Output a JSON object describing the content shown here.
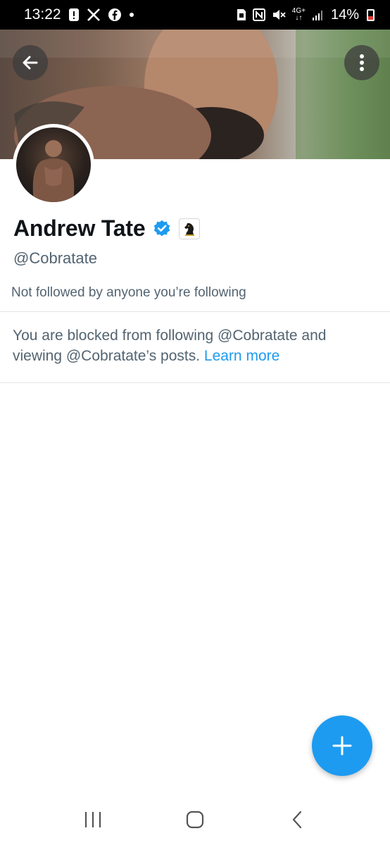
{
  "status_bar": {
    "time": "13:22",
    "network": "4G+",
    "battery": "14%",
    "icons": [
      "alert-icon",
      "x-app-icon",
      "facebook-icon",
      "dot-icon",
      "nfc-icon",
      "mute-icon",
      "signal-icon",
      "battery-icon"
    ]
  },
  "banner": {
    "back_icon": "arrow-left-icon",
    "menu_icon": "more-vertical-icon"
  },
  "profile": {
    "name": "Andrew Tate",
    "handle": "@Cobratate",
    "verified_icon": "verified-badge-icon",
    "affiliate_icon": "chess-knight-icon",
    "followed_by_text": "Not followed by anyone you’re following"
  },
  "blocked_notice": {
    "message": "You are blocked from following @Cobratate and viewing @Cobratate’s posts.",
    "link_label": "Learn more"
  },
  "fab": {
    "icon": "plus-icon"
  },
  "nav": {
    "icons": [
      "recents-icon",
      "home-icon",
      "back-icon"
    ]
  },
  "colors": {
    "accent": "#1d9bf0",
    "secondary_text": "#536471",
    "primary_text": "#0f1419"
  }
}
